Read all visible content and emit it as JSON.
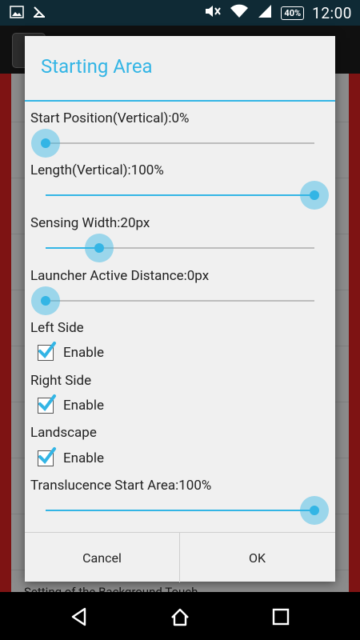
{
  "status_bar": {
    "battery": "40%",
    "time": "12:00",
    "icons": [
      "image-icon",
      "download-icon",
      "mute-icon",
      "wifi-icon",
      "signal-icon",
      "battery-icon"
    ]
  },
  "background": {
    "text": "Setting of the Background Touch"
  },
  "dialog": {
    "title": "Starting Area",
    "sliders": [
      {
        "label": "Start Position(Vertical):0%",
        "value": 0
      },
      {
        "label": "Length(Vertical):100%",
        "value": 1.0
      },
      {
        "label": "Sensing Width:20px",
        "value": 0.2
      },
      {
        "label": "Launcher Active Distance:0px",
        "value": 0
      }
    ],
    "checkbox_groups": [
      {
        "label": "Left Side",
        "option": "Enable",
        "checked": true
      },
      {
        "label": "Right Side",
        "option": "Enable",
        "checked": true
      },
      {
        "label": "Landscape",
        "option": "Enable",
        "checked": true
      }
    ],
    "translucence": {
      "label": "Translucence Start Area:100%",
      "value": 1.0
    },
    "buttons": {
      "cancel": "Cancel",
      "ok": "OK"
    }
  },
  "colors": {
    "accent": "#33b5e5",
    "side_bar": "#cc1f1f"
  }
}
